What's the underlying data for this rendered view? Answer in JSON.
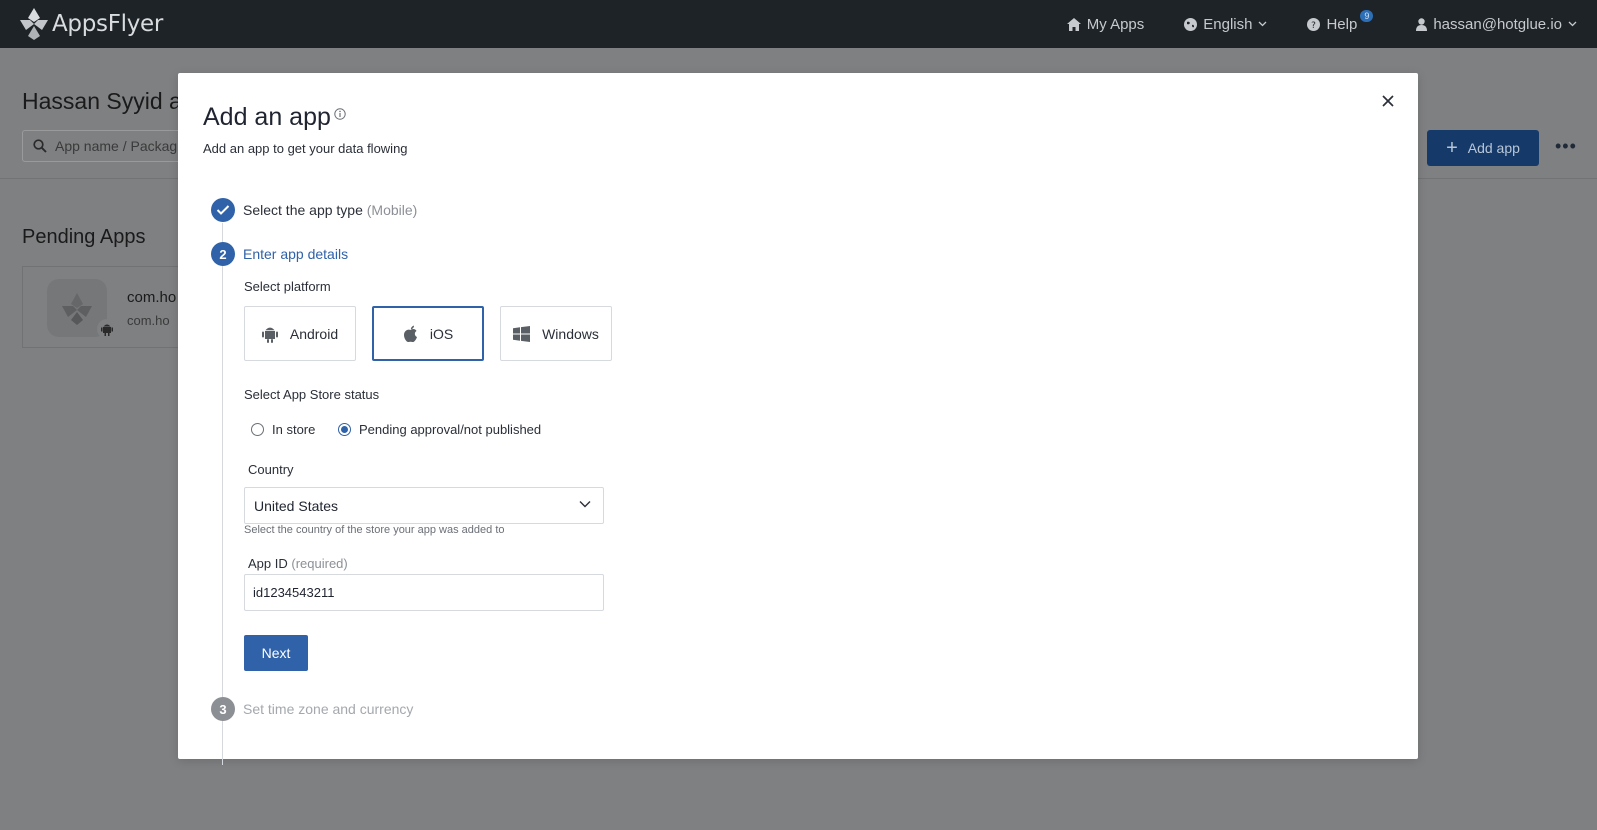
{
  "navbar": {
    "logo_text": "AppsFlyer",
    "my_apps": "My Apps",
    "language": "English",
    "help": "Help",
    "help_badge": "9",
    "user": "hassan@hotglue.io"
  },
  "background": {
    "page_title": "Hassan Syyid a",
    "search_placeholder": "App name / Packag",
    "add_app_label": "Add app",
    "pending_title": "Pending Apps",
    "app_card": {
      "name": "com.ho",
      "package": "com.ho"
    }
  },
  "modal": {
    "title": "Add an app",
    "subtitle": "Add an app to get your data flowing",
    "steps": [
      {
        "number": "1",
        "label": "Select the app type",
        "detail": "(Mobile)",
        "state": "done"
      },
      {
        "number": "2",
        "label": "Enter app details",
        "state": "active"
      },
      {
        "number": "3",
        "label": "Set time zone and currency",
        "state": "pending"
      }
    ],
    "platform_label": "Select platform",
    "platforms": [
      {
        "label": "Android",
        "icon": "android-icon",
        "selected": false
      },
      {
        "label": "iOS",
        "icon": "apple-icon",
        "selected": true
      },
      {
        "label": "Windows",
        "icon": "windows-icon",
        "selected": false
      }
    ],
    "store_status_label": "Select App Store status",
    "store_options": [
      {
        "label": "In store",
        "checked": false
      },
      {
        "label": "Pending approval/not published",
        "checked": true
      }
    ],
    "country_label": "Country",
    "country_value": "United States",
    "country_helper": "Select the country of the store your app was added to",
    "app_id_label": "App ID",
    "app_id_required": "(required)",
    "app_id_value": "id1234543211",
    "next_label": "Next"
  },
  "colors": {
    "navbar_bg": "#1e2327",
    "primary": "#2f62a8",
    "overlay": "#7f8082"
  }
}
